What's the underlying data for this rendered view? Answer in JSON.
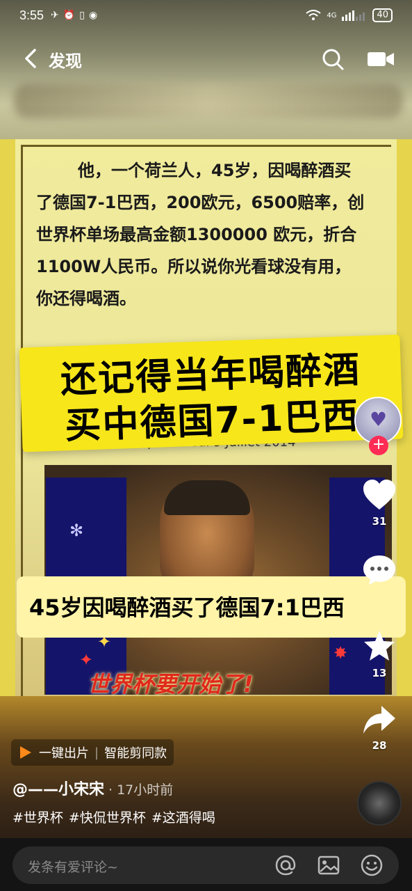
{
  "status_bar": {
    "time": "3:55",
    "left_icons": [
      "✈",
      "⏰",
      "▯",
      "◉"
    ],
    "network": "4G",
    "battery": "40"
  },
  "nav": {
    "title": "发现"
  },
  "article": {
    "lines": [
      "他，一个荷兰人，45岁，因喝醉酒买",
      "了德国7-1巴西，200欧元，6500赔率，创",
      "世界杯单场最高金额1300000 欧元，折合",
      "1100W人民币。所以说你光看球没有用，",
      "你还得喝酒。"
    ]
  },
  "banner_main": {
    "line1": "还记得当年喝醉酒",
    "line2": "买中德国7-1巴西"
  },
  "dateline": "...vision.com | Mercredi 9 Juillet 2014",
  "banner_sub": "45岁因喝醉酒买了德国7:1巴西",
  "caption_red": "世界杯要开始了!",
  "actions": {
    "like_count": "31",
    "comment_count": "",
    "favorite_count": "13",
    "share_count": "28"
  },
  "template_bar": {
    "primary": "一键出片",
    "secondary": "智能剪同款"
  },
  "author": {
    "name": "@——小宋宋",
    "time": "· 17小时前"
  },
  "tags": [
    "#世界杯",
    "#快侃世界杯",
    "#这酒得喝"
  ],
  "comment": {
    "placeholder": "发条有爱评论~"
  },
  "colors": {
    "follow": "#fe2c55",
    "banner": "#f7e61a",
    "caption": "#e0281c"
  },
  "icons": [
    "back-icon",
    "search-icon",
    "camera-icon",
    "heart-icon",
    "comment-icon",
    "star-icon",
    "share-icon",
    "at-icon",
    "image-icon",
    "emoji-icon"
  ]
}
